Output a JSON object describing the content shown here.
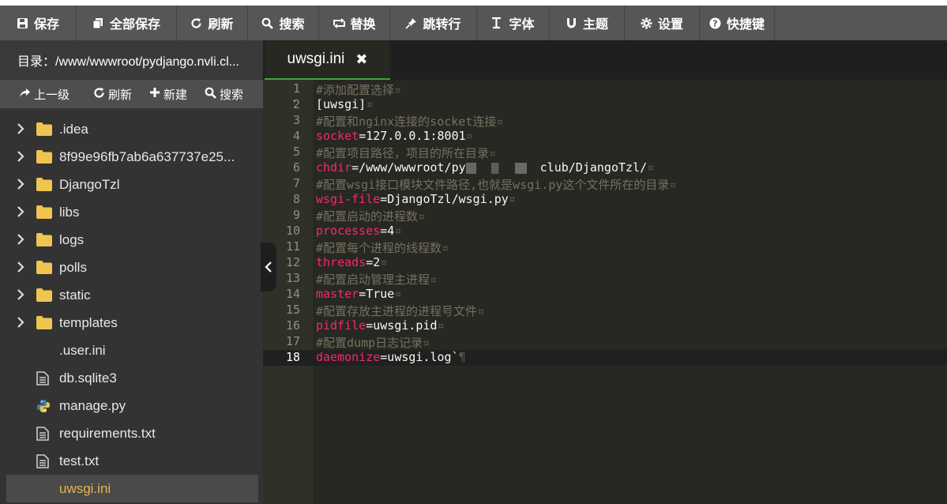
{
  "toolbar": {
    "buttons": [
      {
        "label": "保存",
        "icon": "floppy-icon"
      },
      {
        "label": "全部保存",
        "icon": "files-icon"
      },
      {
        "label": "刷新",
        "icon": "refresh-icon"
      },
      {
        "label": "搜索",
        "icon": "search-icon"
      },
      {
        "label": "替换",
        "icon": "replace-icon"
      },
      {
        "label": "跳转行",
        "icon": "pin-icon"
      },
      {
        "label": "字体",
        "icon": "text-cursor-icon"
      },
      {
        "label": "主题",
        "icon": "magnet-icon"
      },
      {
        "label": "设置",
        "icon": "gear-icon"
      },
      {
        "label": "快捷键",
        "icon": "question-icon"
      }
    ]
  },
  "sidebar": {
    "directory": "目录：/www/wwwroot/pydjango.nvli.cl...",
    "actions": [
      {
        "label": "上一级",
        "icon": "share-arrow-icon"
      },
      {
        "label": "刷新",
        "icon": "refresh-icon"
      },
      {
        "label": "新建",
        "icon": "plus-icon"
      },
      {
        "label": "搜索",
        "icon": "search-icon"
      }
    ],
    "tree": [
      {
        "label": ".idea",
        "type": "folder"
      },
      {
        "label": "8f99e96fb7ab6a637737e25...",
        "type": "folder"
      },
      {
        "label": "DjangoTzl",
        "type": "folder"
      },
      {
        "label": "libs",
        "type": "folder"
      },
      {
        "label": "logs",
        "type": "folder"
      },
      {
        "label": "polls",
        "type": "folder"
      },
      {
        "label": "static",
        "type": "folder"
      },
      {
        "label": "templates",
        "type": "folder"
      },
      {
        "label": ".user.ini",
        "type": "plain"
      },
      {
        "label": "db.sqlite3",
        "type": "file"
      },
      {
        "label": "manage.py",
        "type": "python"
      },
      {
        "label": "requirements.txt",
        "type": "file"
      },
      {
        "label": "test.txt",
        "type": "file"
      },
      {
        "label": "uwsgi.ini",
        "type": "plain",
        "active": true
      }
    ]
  },
  "editor": {
    "tab": {
      "label": "uwsgi.ini",
      "close": "✖"
    },
    "lines": [
      {
        "n": "1",
        "parts": [
          [
            "c-com",
            "#添加配置选择"
          ],
          [
            "c-ws",
            "¤"
          ]
        ]
      },
      {
        "n": "2",
        "fold": "▾",
        "parts": [
          [
            "c-txt",
            "[uwsgi]"
          ],
          [
            "c-ws",
            "¤"
          ]
        ]
      },
      {
        "n": "3",
        "parts": [
          [
            "c-com",
            "#配置和nginx连接的socket连接"
          ],
          [
            "c-ws",
            "¤"
          ]
        ]
      },
      {
        "n": "4",
        "parts": [
          [
            "c-key",
            "socket"
          ],
          [
            "c-txt",
            "=127.0.0.1:8001"
          ],
          [
            "c-ws",
            "¤"
          ]
        ]
      },
      {
        "n": "5",
        "parts": [
          [
            "c-com",
            "#配置项目路径，项目的所在目录"
          ],
          [
            "c-ws",
            "¤"
          ]
        ]
      },
      {
        "n": "6",
        "parts": [
          [
            "c-key",
            "chdir"
          ],
          [
            "c-txt",
            "=/www/wwwroot/py"
          ],
          [
            "blur",
            ""
          ],
          [
            "c-txt",
            "club/DjangoTzl/"
          ],
          [
            "c-ws",
            "¤"
          ]
        ]
      },
      {
        "n": "7",
        "parts": [
          [
            "c-com",
            "#配置wsgi接口模块文件路径,也就是wsgi.py这个文件所在的目录"
          ],
          [
            "c-ws",
            "¤"
          ]
        ]
      },
      {
        "n": "8",
        "parts": [
          [
            "c-key",
            "wsgi-file"
          ],
          [
            "c-txt",
            "=DjangoTzl/wsgi.py"
          ],
          [
            "c-ws",
            "¤"
          ]
        ]
      },
      {
        "n": "9",
        "parts": [
          [
            "c-com",
            "#配置启动的进程数"
          ],
          [
            "c-ws",
            "¤"
          ]
        ]
      },
      {
        "n": "10",
        "parts": [
          [
            "c-key",
            "processes"
          ],
          [
            "c-txt",
            "=4"
          ],
          [
            "c-ws",
            "¤"
          ]
        ]
      },
      {
        "n": "11",
        "parts": [
          [
            "c-com",
            "#配置每个进程的线程数"
          ],
          [
            "c-ws",
            "¤"
          ]
        ]
      },
      {
        "n": "12",
        "parts": [
          [
            "c-key",
            "threads"
          ],
          [
            "c-txt",
            "=2"
          ],
          [
            "c-ws",
            "¤"
          ]
        ]
      },
      {
        "n": "13",
        "parts": [
          [
            "c-com",
            "#配置启动管理主进程"
          ],
          [
            "c-ws",
            "¤"
          ]
        ]
      },
      {
        "n": "14",
        "parts": [
          [
            "c-key",
            "master"
          ],
          [
            "c-txt",
            "=True"
          ],
          [
            "c-ws",
            "¤"
          ]
        ]
      },
      {
        "n": "15",
        "parts": [
          [
            "c-com",
            "#配置存放主进程的进程号文件"
          ],
          [
            "c-ws",
            "¤"
          ]
        ]
      },
      {
        "n": "16",
        "parts": [
          [
            "c-key",
            "pidfile"
          ],
          [
            "c-txt",
            "=uwsgi.pid"
          ],
          [
            "c-ws",
            "¤"
          ]
        ]
      },
      {
        "n": "17",
        "parts": [
          [
            "c-com",
            "#配置dump日志记录"
          ],
          [
            "c-ws",
            "¤"
          ]
        ]
      },
      {
        "n": "18",
        "current": true,
        "parts": [
          [
            "c-key",
            "daemonize"
          ],
          [
            "c-txt",
            "=uwsgi.log`"
          ],
          [
            "c-ws",
            "¶"
          ]
        ]
      }
    ]
  },
  "colors": {
    "accent_green": "#3fa443",
    "active_file": "#e9b64e",
    "keyword": "#f92672",
    "comment": "#75715e"
  }
}
